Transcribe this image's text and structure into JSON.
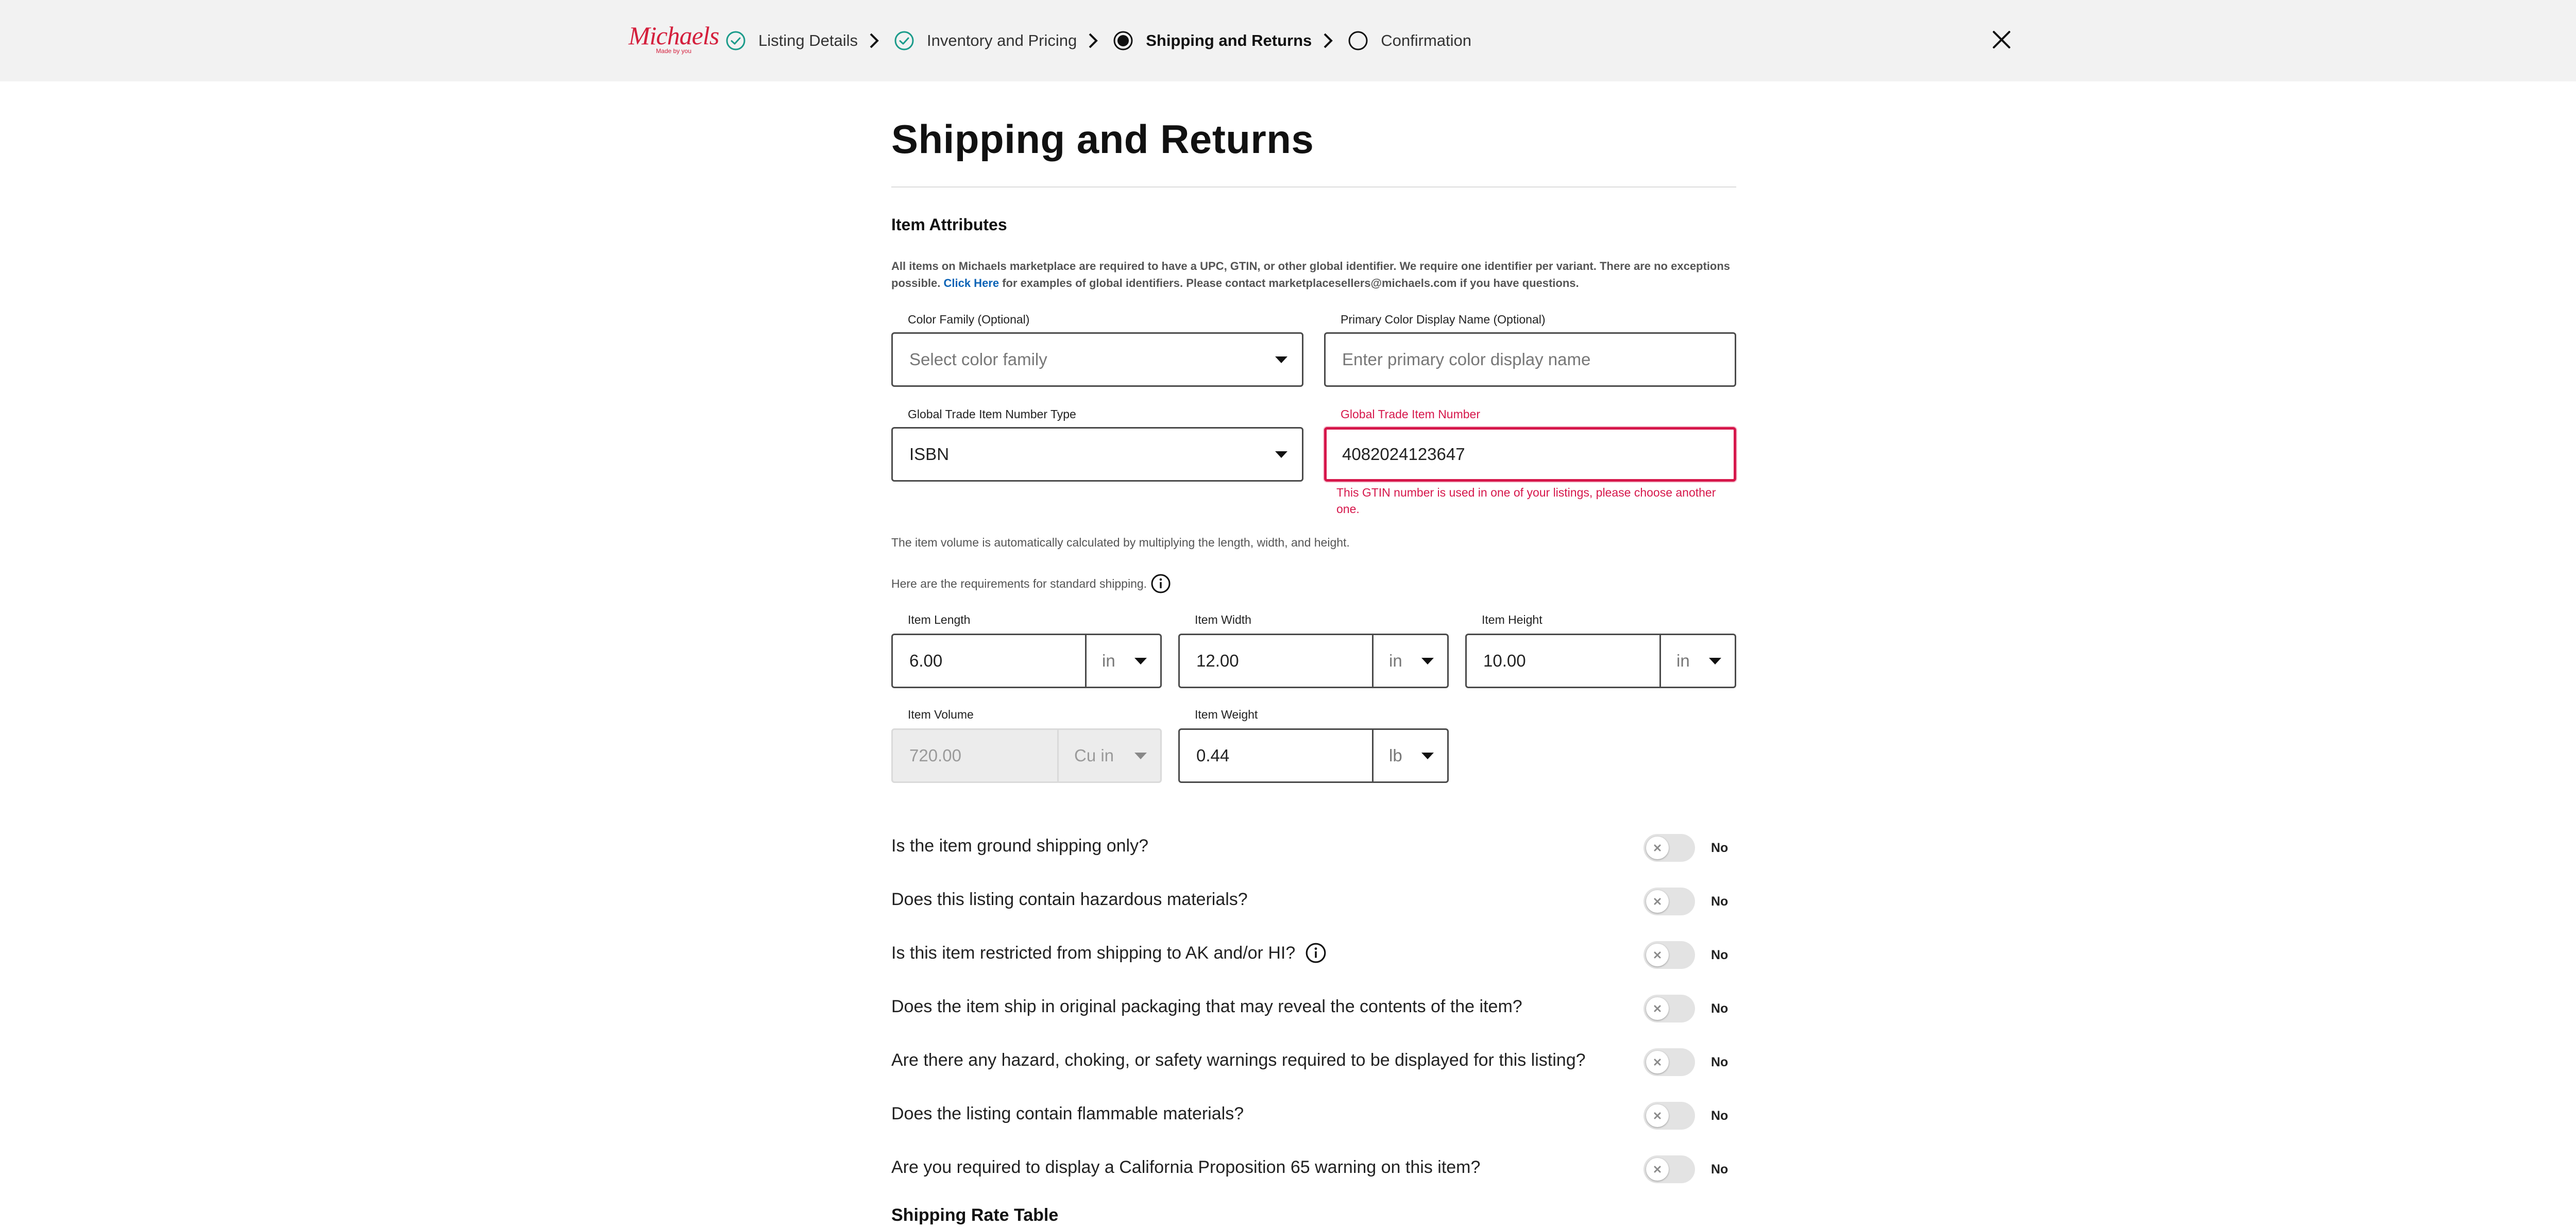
{
  "header": {
    "logo_text": "Michaels",
    "logo_tagline": "Made by you",
    "steps": [
      {
        "label": "Listing Details",
        "state": "done"
      },
      {
        "label": "Inventory and Pricing",
        "state": "done"
      },
      {
        "label": "Shipping and Returns",
        "state": "active"
      },
      {
        "label": "Confirmation",
        "state": "pending"
      }
    ],
    "close_icon": "close-icon"
  },
  "page": {
    "title": "Shipping and Returns",
    "section_title": "Item Attributes",
    "description_1": "All items on Michaels marketplace are required to have a UPC, GTIN, or other global identifier. We require one identifier per variant. There are no exceptions possible.",
    "description_link": "Click Here",
    "description_2": "for examples of global identifiers. Please contact marketplacesellers@michaels.com if you have questions."
  },
  "form": {
    "color_family": {
      "label": "Color Family (Optional)",
      "placeholder": "Select color family"
    },
    "primary_color": {
      "label": "Primary Color Display Name (Optional)",
      "placeholder": "Enter primary color display name"
    },
    "gtin_type": {
      "label": "Global Trade Item Number Type",
      "value": "ISBN"
    },
    "gtin": {
      "label": "Global Trade Item Number",
      "value": "4082024123647",
      "error": "This GTIN number is used in one of your listings, please choose another one."
    },
    "volume_note": "The item volume is automatically calculated by multiplying the length, width, and height.",
    "requirements_note": "Here are the requirements for standard shipping.",
    "item_length": {
      "label": "Item Length",
      "value": "6.00",
      "unit": "in"
    },
    "item_width": {
      "label": "Item Width",
      "value": "12.00",
      "unit": "in"
    },
    "item_height": {
      "label": "Item Height",
      "value": "10.00",
      "unit": "in"
    },
    "item_volume": {
      "label": "Item Volume",
      "value": "720.00",
      "unit": "Cu in"
    },
    "item_weight": {
      "label": "Item Weight",
      "value": "0.44",
      "unit": "lb"
    }
  },
  "questions": [
    {
      "text": "Is the item ground shipping only?",
      "value": "No",
      "info": false
    },
    {
      "text": "Does this listing contain hazardous materials?",
      "value": "No",
      "info": false
    },
    {
      "text": "Is this item restricted from shipping to AK and/or HI?",
      "value": "No",
      "info": true
    },
    {
      "text": "Does the item ship in original packaging that may reveal the contents of the item?",
      "value": "No",
      "info": false
    },
    {
      "text": "Are there any hazard, choking, or safety warnings required to be displayed for this listing?",
      "value": "No",
      "info": false
    },
    {
      "text": "Does the listing contain flammable materials?",
      "value": "No",
      "info": false
    },
    {
      "text": "Are you required to display a California Proposition 65 warning on this item?",
      "value": "No",
      "info": false
    }
  ],
  "shipping_rate_title": "Shipping Rate Table",
  "colors": {
    "brand": "#d41f3c",
    "error": "#d6174b",
    "check": "#1a9b8a",
    "link": "#0b63b6"
  }
}
